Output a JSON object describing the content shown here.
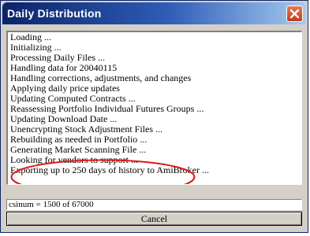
{
  "window": {
    "title": "Daily Distribution"
  },
  "log": {
    "lines": [
      "Loading ...",
      "Initializing ...",
      "Processing Daily Files ...",
      "Handling data for 20040115",
      "Handling corrections, adjustments, and changes",
      "Applying daily price updates",
      "Updating Computed Contracts ...",
      "Reassessing Portfolio Individual Futures Groups ...",
      "Updating Download Date ...",
      "Unencrypting Stock Adjustment Files ...",
      "Rebuilding as needed in Portfolio ...",
      "Generating Market Scanning File ...",
      "Looking for vendors to support ...",
      "Exporting up to 250 days of history to AmiBroker ..."
    ]
  },
  "status": {
    "text": "csinum = 1500 of 67000"
  },
  "buttons": {
    "cancel_label": "Cancel"
  },
  "icons": {
    "close": "close-icon"
  },
  "colors": {
    "titlebar_start": "#0a246a",
    "titlebar_end": "#a6caf0",
    "close_button": "#c23a1a",
    "annotation": "#e01818",
    "dialog_face": "#d4d0c8"
  }
}
